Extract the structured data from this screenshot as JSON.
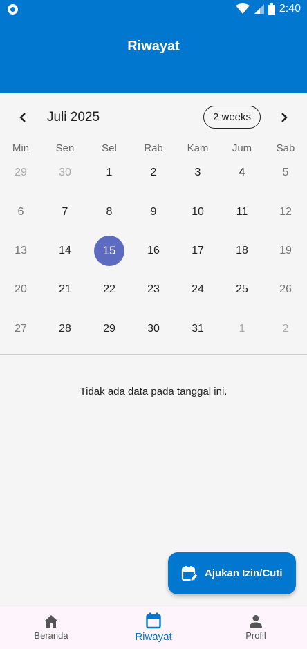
{
  "status_bar": {
    "time": "2:40"
  },
  "app_bar": {
    "title": "Riwayat"
  },
  "calendar": {
    "month_title": "Juli 2025",
    "format_button": "2 weeks",
    "weekdays": [
      "Min",
      "Sen",
      "Sel",
      "Rab",
      "Kam",
      "Jum",
      "Sab"
    ],
    "selected_day": "15",
    "weeks": [
      [
        "29",
        "30",
        "1",
        "2",
        "3",
        "4",
        "5"
      ],
      [
        "6",
        "7",
        "8",
        "9",
        "10",
        "11",
        "12"
      ],
      [
        "13",
        "14",
        "15",
        "16",
        "17",
        "18",
        "19"
      ],
      [
        "20",
        "21",
        "22",
        "23",
        "24",
        "25",
        "26"
      ],
      [
        "27",
        "28",
        "29",
        "30",
        "31",
        "1",
        "2"
      ]
    ]
  },
  "empty_message": "Tidak ada data pada tanggal ini.",
  "fab": {
    "label": "Ajukan Izin/Cuti"
  },
  "bottom_nav": {
    "items": [
      {
        "label": "Beranda",
        "icon": "home-icon"
      },
      {
        "label": "Riwayat",
        "icon": "calendar-icon"
      },
      {
        "label": "Profil",
        "icon": "person-icon"
      }
    ]
  },
  "colors": {
    "primary": "#0277cf",
    "selected_day": "#5c6bc0",
    "background": "#f5f5f5"
  }
}
